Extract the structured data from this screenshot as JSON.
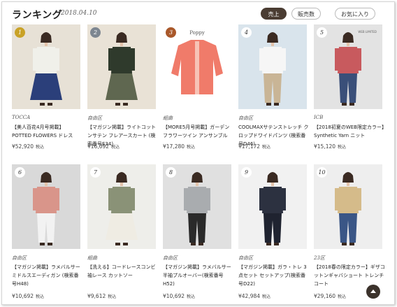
{
  "header": {
    "title": "ランキング",
    "date": "2018.04.10",
    "sort_tabs": [
      {
        "label": "売上",
        "active": true
      },
      {
        "label": "販売数",
        "active": false
      },
      {
        "label": "お気に入り",
        "active": false
      }
    ]
  },
  "products": [
    {
      "rank": "1",
      "brand": "TOCCA",
      "name": "【美人百花4月号掲載】POTTED FLOWERS ドレス",
      "price": "¥52,920",
      "tax": "税込",
      "icon": "dress-photo",
      "bg": "#e7e1d6",
      "top": "#f0f0ea",
      "bottom": "#2b3f7a"
    },
    {
      "rank": "2",
      "brand": "自由区",
      "name": "【マガジン掲載】ライトコットンサテン フレアースカート (検索番号E34)",
      "price": "¥16,092",
      "tax": "税込",
      "icon": "skirt-photo",
      "bg": "#e9e2d6",
      "top": "#2f3a2c",
      "bottom": "#5f6750"
    },
    {
      "rank": "3",
      "brand": "組曲",
      "name": "【MORE5月号掲載】ガーデンフラワーツイン アンサンブル",
      "price": "¥17,280",
      "tax": "税込",
      "icon": "cardigan-photo",
      "bg": "#ffffff",
      "top": "#f07b6a",
      "bottom": "#f7c3b6"
    },
    {
      "rank": "4",
      "brand": "自由区",
      "name": "COOLMAXサテンストレッチ クロップドワイドパンツ (検索番号D46)",
      "price": "¥17,172",
      "tax": "税込",
      "icon": "pants-photo",
      "bg": "#d9e4ec",
      "top": "#f6f6f6",
      "bottom": "#c9b596"
    },
    {
      "rank": "5",
      "brand": "ICB",
      "name": "【2018初夏のWEB限定カラー】Synthetic Yarn ニット",
      "price": "¥15,120",
      "tax": "税込",
      "icon": "knit-photo",
      "bg": "#e3e3e3",
      "top": "#c85a5e",
      "bottom": "#3a4f79",
      "note": "WEB LIMITED"
    },
    {
      "rank": "6",
      "brand": "自由区",
      "name": "【マガジン掲載】ラメバルサーミドルスエーディガン (検索番号H48)",
      "price": "¥10,692",
      "tax": "税込",
      "icon": "cardigan-long-photo",
      "bg": "#d9d9d9",
      "top": "#d9958a",
      "bottom": "#f2f2f2"
    },
    {
      "rank": "7",
      "brand": "組曲",
      "name": "【洗える】コードレースコンビ袖レース カットソー",
      "price": "¥9,612",
      "tax": "税込",
      "icon": "blouse-photo",
      "bg": "#eeeeea",
      "top": "#8a9277",
      "bottom": "#efece3"
    },
    {
      "rank": "8",
      "brand": "自由区",
      "name": "【マガジン掲載】ラメバルサー半袖プルオーバー(検索番号H52)",
      "price": "¥10,692",
      "tax": "税込",
      "icon": "pullover-photo",
      "bg": "#e0e0e0",
      "top": "#a9acaf",
      "bottom": "#2a2a2a"
    },
    {
      "rank": "9",
      "brand": "自由区",
      "name": "【マガジン掲載】ガラ・トレ 3点セット セットアップ(検索番号D22)",
      "price": "¥42,984",
      "tax": "税込",
      "icon": "setup-photo",
      "bg": "#f1f1f1",
      "top": "#2c3140",
      "bottom": "#1f2330"
    },
    {
      "rank": "10",
      "brand": "23区",
      "name": "【2018春の限定カラー】ギザコットンギャバショート トレンチコート",
      "price": "¥29,160",
      "tax": "税込",
      "icon": "trench-coat-photo",
      "bg": "#eeeeee",
      "top": "#d5bb8a",
      "bottom": "#3a5686"
    }
  ],
  "cardigan_logo": "Poppy",
  "ui": {
    "back_to_top": "chevron-up-icon"
  }
}
